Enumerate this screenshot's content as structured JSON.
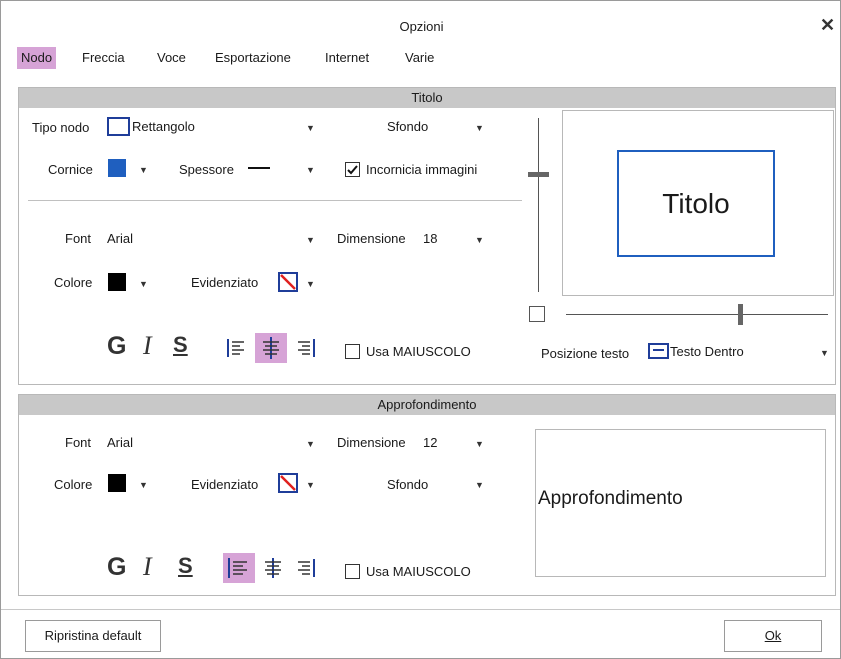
{
  "window": {
    "title": "Opzioni"
  },
  "tabs": [
    {
      "label": "Nodo",
      "active": true
    },
    {
      "label": "Freccia"
    },
    {
      "label": "Voce"
    },
    {
      "label": "Esportazione"
    },
    {
      "label": "Internet"
    },
    {
      "label": "Varie"
    }
  ],
  "titolo": {
    "header": "Titolo",
    "tipo_nodo_label": "Tipo nodo",
    "tipo_nodo_value": "Rettangolo",
    "sfondo_label": "Sfondo",
    "cornice_label": "Cornice",
    "cornice_color": "#1f5fbf",
    "spessore_label": "Spessore",
    "incornicia_label": "Incornicia immagini",
    "incornicia_checked": true,
    "font_label": "Font",
    "font_value": "Arial",
    "dimensione_label": "Dimensione",
    "dimensione_value": "18",
    "colore_label": "Colore",
    "colore_value": "#000000",
    "evidenziato_label": "Evidenziato",
    "bold_glyph": "G",
    "italic_glyph": "I",
    "underline_glyph": "S",
    "maiuscolo_label": "Usa MAIUSCOLO",
    "maiuscolo_checked": false,
    "alignment": "center",
    "posizione_label": "Posizione testo",
    "posizione_value": "Testo Dentro",
    "preview_text": "Titolo"
  },
  "approfondimento": {
    "header": "Approfondimento",
    "font_label": "Font",
    "font_value": "Arial",
    "dimensione_label": "Dimensione",
    "dimensione_value": "12",
    "colore_label": "Colore",
    "colore_value": "#000000",
    "evidenziato_label": "Evidenziato",
    "sfondo_label": "Sfondo",
    "bold_glyph": "G",
    "italic_glyph": "I",
    "underline_glyph": "S",
    "maiuscolo_label": "Usa MAIUSCOLO",
    "maiuscolo_checked": false,
    "alignment": "left",
    "preview_text": "Approfondimento"
  },
  "footer": {
    "reset_label": "Ripristina default",
    "ok_label": "Ok"
  },
  "colors": {
    "accent": "#d6a3d6",
    "band": "#c8c8c8",
    "preview_border": "#1f5fbf"
  }
}
